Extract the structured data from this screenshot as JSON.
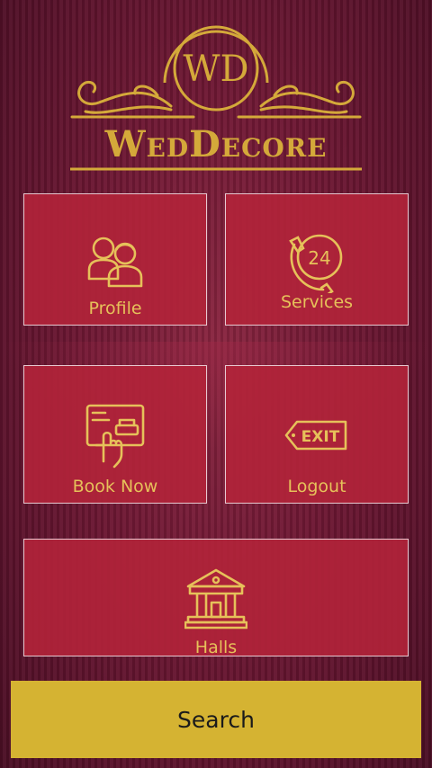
{
  "brand": {
    "monogram": "WD",
    "name": "WedDecore"
  },
  "tiles": {
    "profile": {
      "label": "Profile",
      "icon": "users-icon"
    },
    "services": {
      "label": "Services",
      "icon": "phone-24-icon",
      "badge": "24"
    },
    "book_now": {
      "label": "Book Now",
      "icon": "tablet-booking-icon"
    },
    "logout": {
      "label": "Logout",
      "icon": "exit-sign-icon",
      "sign_text": "EXIT"
    },
    "halls": {
      "label": "Halls",
      "icon": "hall-building-icon"
    }
  },
  "search": {
    "label": "Search"
  },
  "colors": {
    "background": "#6d1733",
    "tile": "#b2243a",
    "gold": "#d4a93a",
    "button": "#d5b332"
  }
}
